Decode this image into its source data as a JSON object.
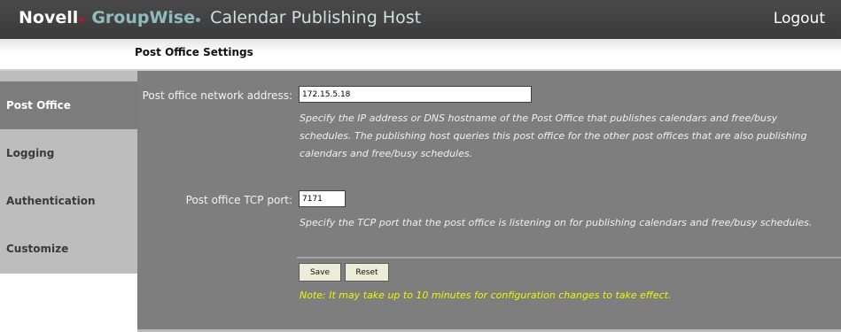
{
  "header": {
    "brand_novell": "Novell",
    "brand_groupwise": "GroupWise",
    "brand_subtitle": "Calendar Publishing Host",
    "logout_label": "Logout"
  },
  "page": {
    "title": "Post Office Settings"
  },
  "sidebar": {
    "items": [
      {
        "label": "Post Office",
        "active": true
      },
      {
        "label": "Logging",
        "active": false
      },
      {
        "label": "Authentication",
        "active": false
      },
      {
        "label": "Customize",
        "active": false
      }
    ]
  },
  "form": {
    "address_label": "Post office network address:",
    "address_value": "172.15.5.18",
    "address_help": "Specify the IP address or DNS hostname of the Post Office that publishes calendars and free/busy schedules. The publishing host queries this post office for the other post offices that are also publishing calendars and free/busy schedules.",
    "port_label": "Post office TCP port:",
    "port_value": "7171",
    "port_help": "Specify the TCP port that the post office is listening on for publishing calendars and free/busy schedules.",
    "save_label": "Save",
    "reset_label": "Reset",
    "note": "Note: It may take up to 10 minutes for configuration changes to take effect."
  },
  "colors": {
    "header_bg": "#3f3f3f",
    "groupwise_teal": "#8fbcbd",
    "novell_red_dot": "#c8102e",
    "main_bg": "#7e7e7e",
    "sidebar_bg": "#bdbdbd",
    "active_nav_bg": "#7c7c7c",
    "note_yellow": "#f5f500",
    "button_bg": "#ececd8"
  }
}
